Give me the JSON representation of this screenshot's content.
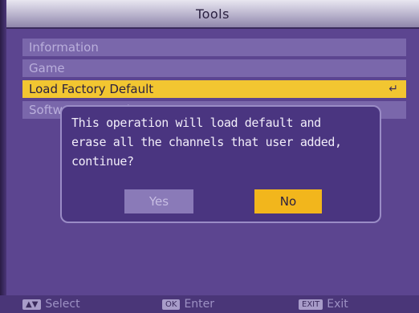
{
  "title": "Tools",
  "menu": {
    "items": [
      {
        "label": "Information",
        "selected": false
      },
      {
        "label": "Game",
        "selected": false
      },
      {
        "label": "Load Factory Default",
        "selected": true
      },
      {
        "label": "Software Upgrade",
        "selected": false
      }
    ]
  },
  "dialog": {
    "lines": [
      "This operation will load default and",
      "erase all the channels that user added,",
      "continue?"
    ],
    "yes_label": "Yes",
    "no_label": "No",
    "focused": "No"
  },
  "footer": {
    "select": {
      "key": "▲▼",
      "label": "Select"
    },
    "enter": {
      "key": "OK",
      "label": "Enter"
    },
    "exit": {
      "key": "EXIT",
      "label": "Exit"
    }
  },
  "colors": {
    "background": "#5c4590",
    "highlight": "#f2c631",
    "menu_item": "#7a67ab",
    "dialog": "#4a3580"
  },
  "icons": {
    "enter_mark": "enter-arrow-icon"
  }
}
